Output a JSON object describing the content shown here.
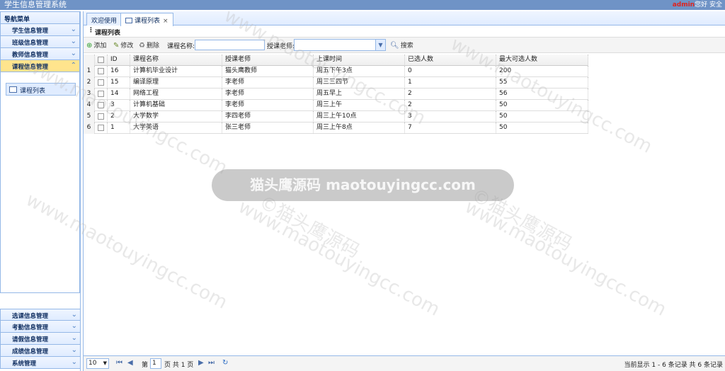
{
  "app": {
    "title": "学生信息管理系统",
    "user": "admin",
    "greeting": "您好",
    "security": "安全"
  },
  "sidebar": {
    "header": "导航菜单",
    "top_items": [
      {
        "label": "学生信息管理"
      },
      {
        "label": "班级信息管理"
      },
      {
        "label": "教师信息管理"
      },
      {
        "label": "课程信息管理"
      }
    ],
    "sub_item": "课程列表",
    "bottom_items": [
      {
        "label": "选课信息管理"
      },
      {
        "label": "考勤信息管理"
      },
      {
        "label": "请假信息管理"
      },
      {
        "label": "成绩信息管理"
      },
      {
        "label": "系统管理"
      }
    ]
  },
  "tabs": [
    {
      "label": "欢迎使用"
    },
    {
      "label": "课程列表"
    }
  ],
  "panel": {
    "title": "课程列表"
  },
  "toolbar": {
    "add": "添加",
    "edit": "修改",
    "delete": "删除",
    "course_name_label": "课程名称:",
    "teacher_label": "授课老师:",
    "search": "搜索"
  },
  "grid": {
    "columns": [
      "ID",
      "课程名称",
      "授课老师",
      "上课时间",
      "已选人数",
      "最大可选人数"
    ],
    "rows": [
      {
        "n": "1",
        "id": "16",
        "name": "计算机毕业设计",
        "teacher": "猫头鹰教师",
        "time": "周五下午3点",
        "selected": "0",
        "max": "200"
      },
      {
        "n": "2",
        "id": "15",
        "name": "编译原理",
        "teacher": "李老师",
        "time": "周三三四节",
        "selected": "1",
        "max": "55"
      },
      {
        "n": "3",
        "id": "14",
        "name": "网络工程",
        "teacher": "李老师",
        "time": "周五早上",
        "selected": "2",
        "max": "56"
      },
      {
        "n": "4",
        "id": "3",
        "name": "计算机基础",
        "teacher": "李老师",
        "time": "周三上午",
        "selected": "2",
        "max": "50"
      },
      {
        "n": "5",
        "id": "2",
        "name": "大学数学",
        "teacher": "李四老师",
        "time": "周三上午10点",
        "selected": "3",
        "max": "50"
      },
      {
        "n": "6",
        "id": "1",
        "name": "大学英语",
        "teacher": "张三老师",
        "time": "周三上午8点",
        "selected": "7",
        "max": "50"
      }
    ]
  },
  "pager": {
    "page_size": "10",
    "page_prefix": "第",
    "page": "1",
    "page_suffix": "页 共 1 页",
    "info": "当前显示 1 - 6 条记录 共 6 条记录"
  },
  "watermark": {
    "banner": "猫头鹰源码 maotouyingcc.com",
    "text": "www.maotouyingcc.com",
    "symbol": "©猫头鹰源码"
  }
}
